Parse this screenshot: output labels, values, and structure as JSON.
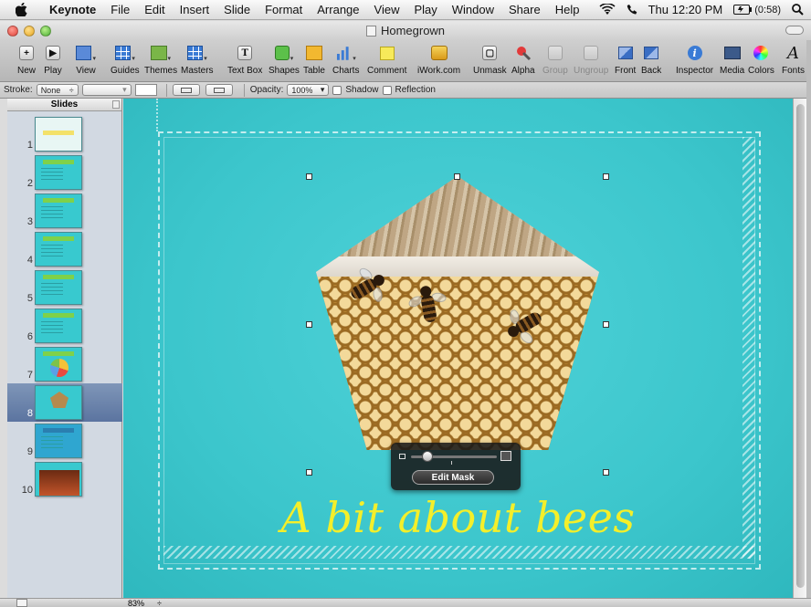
{
  "menubar": {
    "app_name": "Keynote",
    "menus": [
      "File",
      "Edit",
      "Insert",
      "Slide",
      "Format",
      "Arrange",
      "View",
      "Play",
      "Window",
      "Share",
      "Help"
    ],
    "clock": "Thu 12:20 PM",
    "battery": "(0:58)"
  },
  "window": {
    "title": "Homegrown"
  },
  "toolbar": {
    "new": "New",
    "play": "Play",
    "view": "View",
    "guides": "Guides",
    "themes": "Themes",
    "masters": "Masters",
    "text_box": "Text Box",
    "shapes": "Shapes",
    "table": "Table",
    "charts": "Charts",
    "comment": "Comment",
    "iwork": "iWork.com",
    "unmask": "Unmask",
    "alpha": "Alpha",
    "group": "Group",
    "ungroup": "Ungroup",
    "front": "Front",
    "back": "Back",
    "inspector": "Inspector",
    "media": "Media",
    "colors": "Colors",
    "fonts": "Fonts"
  },
  "formatbar": {
    "stroke_label": "Stroke:",
    "stroke_value": "None",
    "opacity_label": "Opacity:",
    "opacity_value": "100%",
    "shadow_label": "Shadow",
    "reflection_label": "Reflection"
  },
  "navigator": {
    "header": "Slides",
    "slides": [
      {
        "num": "1"
      },
      {
        "num": "2"
      },
      {
        "num": "3"
      },
      {
        "num": "4"
      },
      {
        "num": "5"
      },
      {
        "num": "6"
      },
      {
        "num": "7"
      },
      {
        "num": "8"
      },
      {
        "num": "9"
      },
      {
        "num": "10"
      }
    ],
    "selected": 8
  },
  "slide": {
    "title": "A bit about bees",
    "title_color": "#f4ef2a",
    "background_color": "#3cc6cc"
  },
  "mask_hud": {
    "edit_button": "Edit Mask"
  },
  "statusbar": {
    "zoom": "83%"
  },
  "colors": {
    "selection": "#5b74a0",
    "accent": "#3cc6cc"
  }
}
